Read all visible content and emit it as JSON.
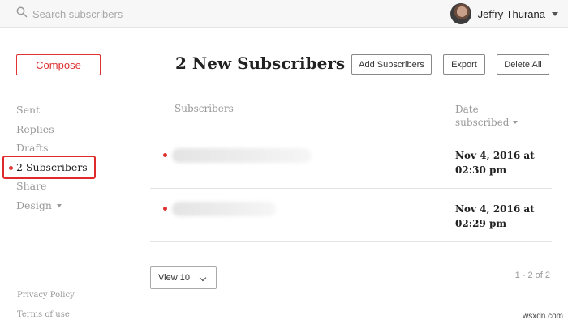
{
  "header": {
    "search_placeholder": "Search subscribers",
    "user_name": "Jeffry Thurana"
  },
  "sidebar": {
    "compose_label": "Compose",
    "items": [
      {
        "label": "Sent"
      },
      {
        "label": "Replies"
      },
      {
        "label": "Drafts"
      },
      {
        "label": "2 Subscribers",
        "active": true
      },
      {
        "label": "Share"
      },
      {
        "label": "Design"
      }
    ],
    "footer": {
      "privacy": "Privacy Policy",
      "terms": "Terms of use"
    }
  },
  "main": {
    "title": "2 New Subscribers",
    "toolbar": {
      "add_label": "Add Subscribers",
      "export_label": "Export",
      "delete_label": "Delete All"
    },
    "table": {
      "col_subscribers": "Subscribers",
      "col_date_line1": "Date",
      "col_date_line2": "subscribed",
      "rows": [
        {
          "date_line1": "Nov 4, 2016 at",
          "date_line2": "02:30 pm"
        },
        {
          "date_line1": "Nov 4, 2016 at",
          "date_line2": "02:29 pm"
        }
      ]
    },
    "view_label": "View 10",
    "pagination": "1 - 2 of 2"
  },
  "watermark": "wsxdn.com",
  "colors": {
    "accent": "#dd3333",
    "highlight_box": "#e02a2a"
  }
}
